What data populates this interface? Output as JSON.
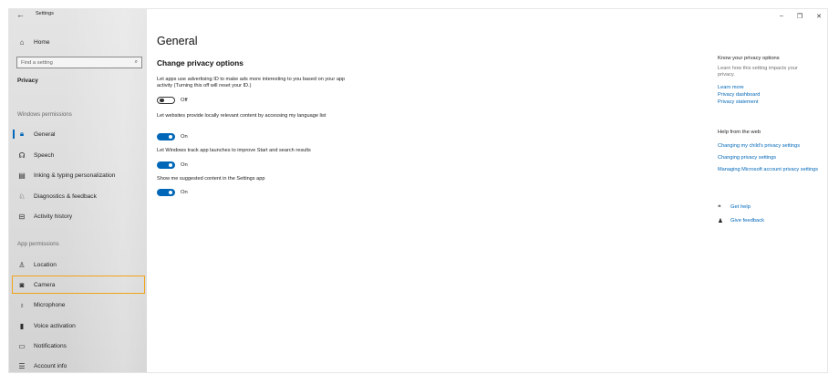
{
  "window": {
    "app_title": "Settings",
    "controls": {
      "minimize": "–",
      "restore": "❐",
      "close": "✕"
    }
  },
  "sidebar": {
    "home_label": "Home",
    "search_placeholder": "Find a setting",
    "privacy_heading": "Privacy",
    "windows_permissions_label": "Windows permissions",
    "windows_permissions": [
      {
        "label": "General",
        "icon": "lock-icon"
      },
      {
        "label": "Speech",
        "icon": "speech-icon"
      },
      {
        "label": "Inking & typing personalization",
        "icon": "inking-icon"
      },
      {
        "label": "Diagnostics & feedback",
        "icon": "diagnostics-icon"
      },
      {
        "label": "Activity history",
        "icon": "activity-history-icon"
      }
    ],
    "app_permissions_label": "App permissions",
    "app_permissions": [
      {
        "label": "Location",
        "icon": "location-icon"
      },
      {
        "label": "Camera",
        "icon": "camera-icon"
      },
      {
        "label": "Microphone",
        "icon": "microphone-icon"
      },
      {
        "label": "Voice activation",
        "icon": "voice-activation-icon"
      },
      {
        "label": "Notifications",
        "icon": "notifications-icon"
      },
      {
        "label": "Account info",
        "icon": "account-info-icon"
      }
    ]
  },
  "main": {
    "title": "General",
    "subheading": "Change privacy options",
    "settings": [
      {
        "description": "Let apps use advertising ID to make ads more interesting to you based on your app activity (Turning this off will reset your ID.)",
        "state": "Off"
      },
      {
        "description": "Let websites provide locally relevant content by accessing my language list",
        "state": "On"
      },
      {
        "description": "Let Windows track app launches to improve Start and search results",
        "state": "On"
      },
      {
        "description": "Show me suggested content in the Settings app",
        "state": "On"
      }
    ]
  },
  "right": {
    "know_heading": "Know your privacy options",
    "know_text": "Learn how this setting impacts your privacy.",
    "links": [
      "Learn more",
      "Privacy dashboard",
      "Privacy statement"
    ],
    "web_heading": "Help from the web",
    "web_links": [
      "Changing my child's privacy settings",
      "Changing privacy settings",
      "Managing Microsoft account privacy settings"
    ],
    "get_help": "Get help",
    "give_feedback": "Give feedback"
  },
  "colors": {
    "accent": "#0067b8",
    "highlight": "#f0a41a"
  }
}
